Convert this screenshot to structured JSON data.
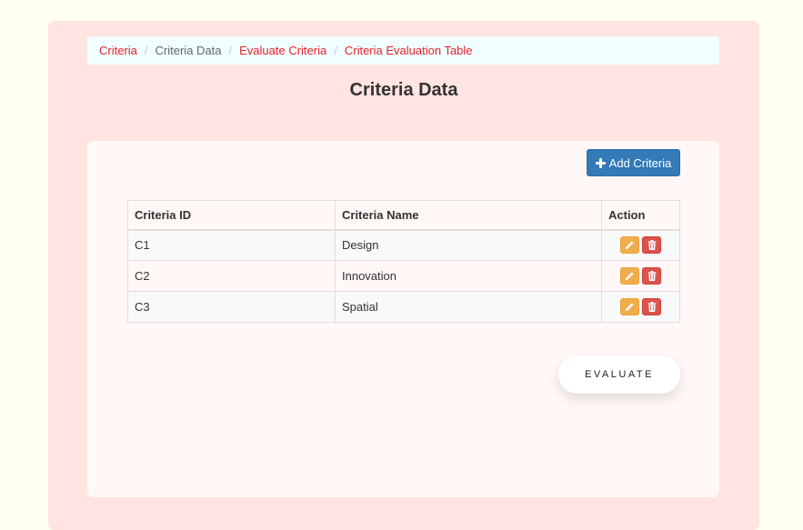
{
  "breadcrumb": {
    "items": [
      {
        "label": "Criteria",
        "active": false
      },
      {
        "label": "Criteria Data",
        "active": true
      },
      {
        "label": "Evaluate Criteria",
        "active": false
      },
      {
        "label": "Criteria Evaluation Table",
        "active": false
      }
    ],
    "separator": "/"
  },
  "page": {
    "title": "Criteria Data"
  },
  "toolbar": {
    "add_label": "Add Criteria",
    "add_icon": "plus-icon"
  },
  "table": {
    "headers": {
      "id": "Criteria ID",
      "name": "Criteria Name",
      "action": "Action"
    },
    "rows": [
      {
        "id": "C1",
        "name": "Design"
      },
      {
        "id": "C2",
        "name": "Innovation"
      },
      {
        "id": "C3",
        "name": "Spatial"
      }
    ],
    "row_actions": [
      "pencil-icon",
      "trash-icon"
    ]
  },
  "evaluate": {
    "label": "EVALUATE"
  },
  "colors": {
    "page_bg": "#fffff0",
    "outer_bg": "#ffe4e1",
    "breadcrumb_bg": "#f0ffff",
    "link": "#e8212b",
    "primary": "#337ab7",
    "warning": "#f0ad4e",
    "danger": "#d9534f"
  }
}
